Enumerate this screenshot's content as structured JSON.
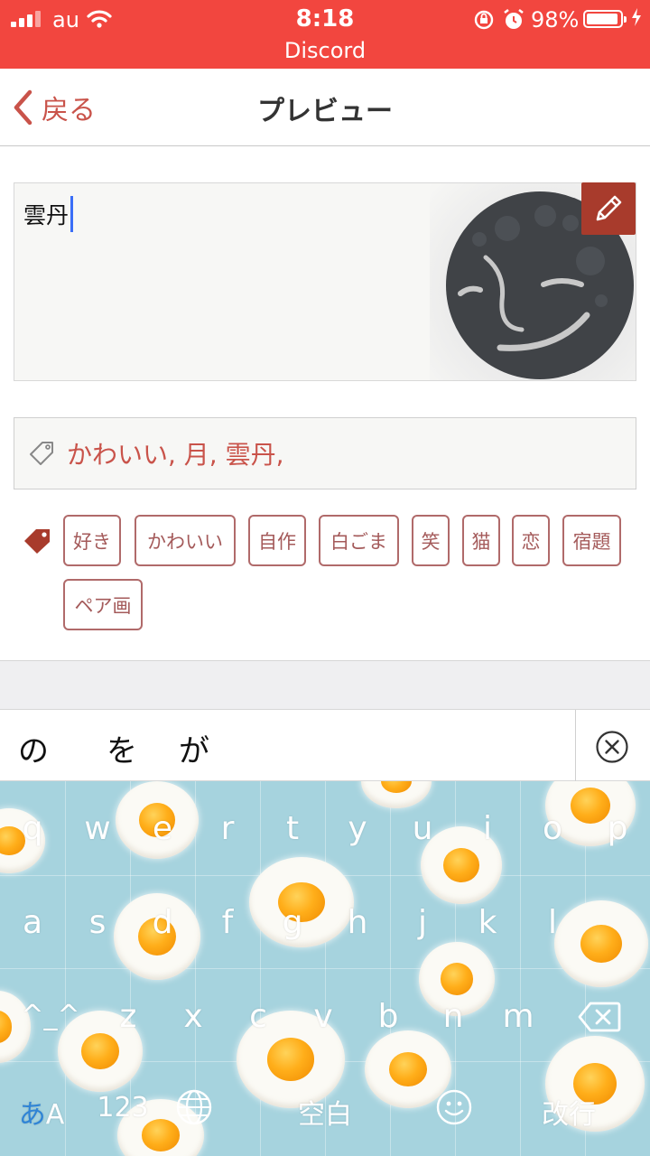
{
  "status_bar": {
    "carrier": "au",
    "time": "8:18",
    "app_label": "Discord",
    "battery_percent": "98%",
    "background_color": "#f2463f"
  },
  "nav": {
    "back_label": "戻る",
    "title": "プレビュー",
    "accent_color": "#c9534a"
  },
  "editor": {
    "text": "雲丹",
    "edit_icon": "pencil-icon",
    "image_description_icon": "smiling-moon-icon"
  },
  "tag_input": {
    "icon": "tag-outline-icon",
    "value": "かわいい, 月, 雲丹,"
  },
  "suggested_tags": {
    "icon": "tag-filled-icon",
    "items": [
      "好き",
      "かわいい",
      "自作",
      "白ごま",
      "笑",
      "猫",
      "恋",
      "宿題",
      "ペア画"
    ]
  },
  "prediction_bar": {
    "candidates": [
      "の",
      "を",
      "が"
    ],
    "clear_icon": "circle-x-icon"
  },
  "keyboard": {
    "row1": [
      "q",
      "w",
      "e",
      "r",
      "t",
      "y",
      "u",
      "i",
      "o",
      "p"
    ],
    "row2": [
      "a",
      "s",
      "d",
      "f",
      "g",
      "h",
      "j",
      "k",
      "l"
    ],
    "row3": [
      "^_^",
      "z",
      "x",
      "c",
      "v",
      "b",
      "n",
      "m"
    ],
    "mode_label": "あA",
    "mode_label_kana": "あ",
    "mode_label_latin": "A",
    "number_label": "123",
    "space_label": "空白",
    "return_label": "改行",
    "globe_icon": "globe-icon",
    "emoji_icon": "smiley-icon",
    "backspace_icon": "backspace-icon",
    "background_color": "#a6d3de"
  }
}
